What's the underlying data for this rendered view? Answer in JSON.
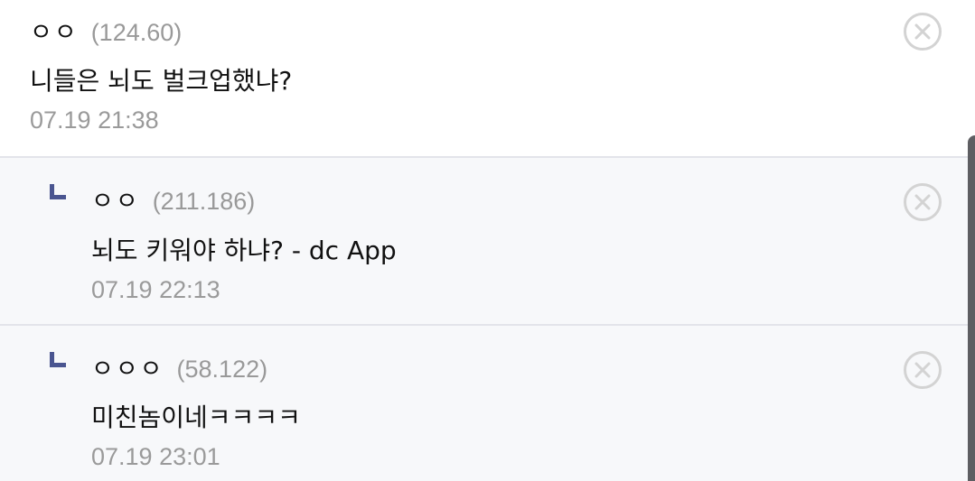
{
  "comments": [
    {
      "nick": "ㅇㅇ",
      "ip": "(124.60)",
      "text": "니들은 뇌도 벌크업했냐?",
      "date": "07.19 21:38",
      "reply": false
    },
    {
      "nick": "ㅇㅇ",
      "ip": "(211.186)",
      "text": "뇌도 키워야 하냐? - dc App",
      "date": "07.19 22:13",
      "reply": true
    },
    {
      "nick": "ㅇㅇㅇ",
      "ip": "(58.122)",
      "text": "미친놈이네ㅋㅋㅋㅋ",
      "date": "07.19 23:01",
      "reply": true
    }
  ],
  "icons": {
    "delete": "close-circle-icon",
    "reply": "reply-corner-icon"
  },
  "colors": {
    "reply_mark": "#4a5590",
    "ip": "#999999",
    "reply_bg": "#f7f8fa"
  }
}
